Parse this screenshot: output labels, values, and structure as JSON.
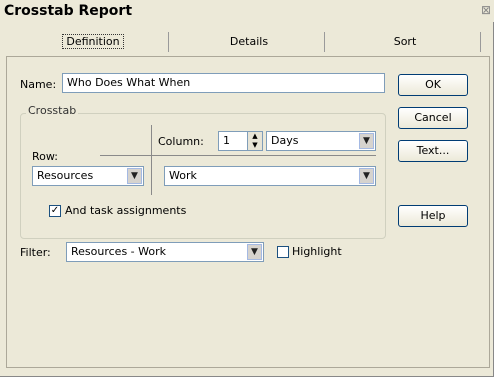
{
  "window": {
    "title": "Crosstab Report",
    "close_glyph": "⊠"
  },
  "tabs": [
    "Definition",
    "Details",
    "Sort"
  ],
  "name": {
    "label": "Name:",
    "value": "Who Does What When"
  },
  "crosstab": {
    "group_label": "Crosstab",
    "column_label": "Column:",
    "column_value": "1",
    "column_unit": "Days",
    "row_label": "Row:",
    "row_value": "Resources",
    "field_value": "Work",
    "task_assignments_label": "And task assignments",
    "task_assignments_checked": true
  },
  "filter": {
    "label": "Filter:",
    "value": "Resources - Work",
    "highlight_label": "Highlight",
    "highlight_checked": false
  },
  "buttons": {
    "ok": "OK",
    "cancel": "Cancel",
    "text": "Text...",
    "help": "Help"
  }
}
